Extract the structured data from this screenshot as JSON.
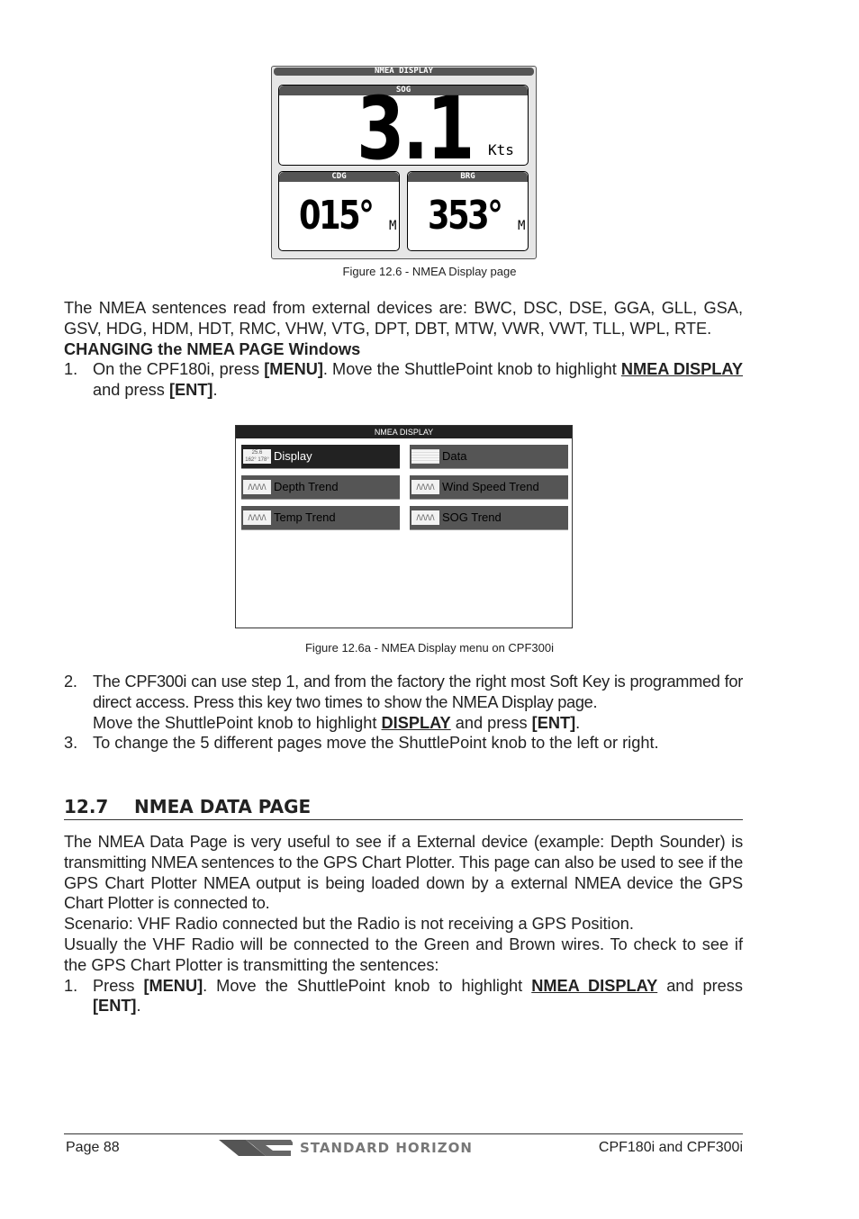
{
  "figure1": {
    "title": "NMEA DISPLAY",
    "sog": {
      "label": "SOG",
      "value": "3.1",
      "unit": "Kts"
    },
    "cdg": {
      "label": "CDG",
      "value": "015°",
      "unit": "M"
    },
    "brg": {
      "label": "BRG",
      "value": "353°",
      "unit": "M"
    },
    "caption": "Figure 12.6 -  NMEA Display page"
  },
  "para1": "The NMEA sentences read from external devices are: BWC, DSC, DSE, GGA, GLL, GSA, GSV, HDG, HDM, HDT, RMC, VHW, VTG, DPT, DBT, MTW, VWR, VWT, TLL, WPL, RTE.",
  "subheading": "CHANGING the NMEA PAGE Windows",
  "step1": {
    "n": "1.",
    "a": "On the CPF180i, press ",
    "b": "[MENU]",
    "c": ". Move the ShuttlePoint knob to highlight ",
    "d": "NMEA DISPLAY",
    "e": " and press ",
    "f": "[ENT]",
    "g": "."
  },
  "figure2": {
    "title": "NMEA DISPLAY",
    "items": [
      {
        "label": "Display",
        "icon": "display-thumbnail-icon",
        "thumb_top": "25.6",
        "thumb_left": "162°",
        "thumb_right": "178°"
      },
      {
        "label": "Data",
        "icon": "data-list-icon"
      },
      {
        "label": "Depth Trend",
        "icon": "trend-graph-icon"
      },
      {
        "label": "Wind Speed Trend",
        "icon": "trend-graph-icon"
      },
      {
        "label": "Temp Trend",
        "icon": "trend-graph-icon"
      },
      {
        "label": "SOG Trend",
        "icon": "trend-graph-icon"
      }
    ],
    "caption": "Figure 12.6a - NMEA Display menu on CPF300i"
  },
  "step2": {
    "n": "2.",
    "a": "The CPF300i can use step 1, and from the factory the right most Soft Key is programmed for direct access. Press this key two times to show the NMEA Display page.",
    "b": "Move the ShuttlePoint knob to highlight ",
    "c": "DISPLAY",
    "d": " and press ",
    "e": "[ENT]",
    "f": "."
  },
  "step3": {
    "n": "3.",
    "text": "To change the 5 different pages move the ShuttlePoint knob to the left or right."
  },
  "section": {
    "number": "12.7",
    "title": "NMEA DATA PAGE"
  },
  "para2": "The NMEA Data Page is very useful to see if a External device (example: Depth Sounder) is transmitting NMEA sentences to the GPS Chart Plotter. This page can also be used to see if the GPS Chart Plotter NMEA output is being loaded down by a external NMEA device the GPS Chart Plotter is connected to.",
  "para3": "Scenario: VHF Radio connected but the Radio is not receiving a GPS Position.",
  "para4": "Usually the VHF Radio will be connected to the Green and Brown wires. To check to see if the GPS Chart Plotter is transmitting the sentences:",
  "step4": {
    "n": "1.",
    "a": "Press ",
    "b": "[MENU]",
    "c": ". Move the ShuttlePoint knob to highlight ",
    "d": "NMEA DISPLAY",
    "e": " and press ",
    "f": "[ENT]",
    "g": "."
  },
  "footer": {
    "page": "Page  88",
    "brand": "STANDARD HORIZON",
    "model": "CPF180i and CPF300i"
  }
}
